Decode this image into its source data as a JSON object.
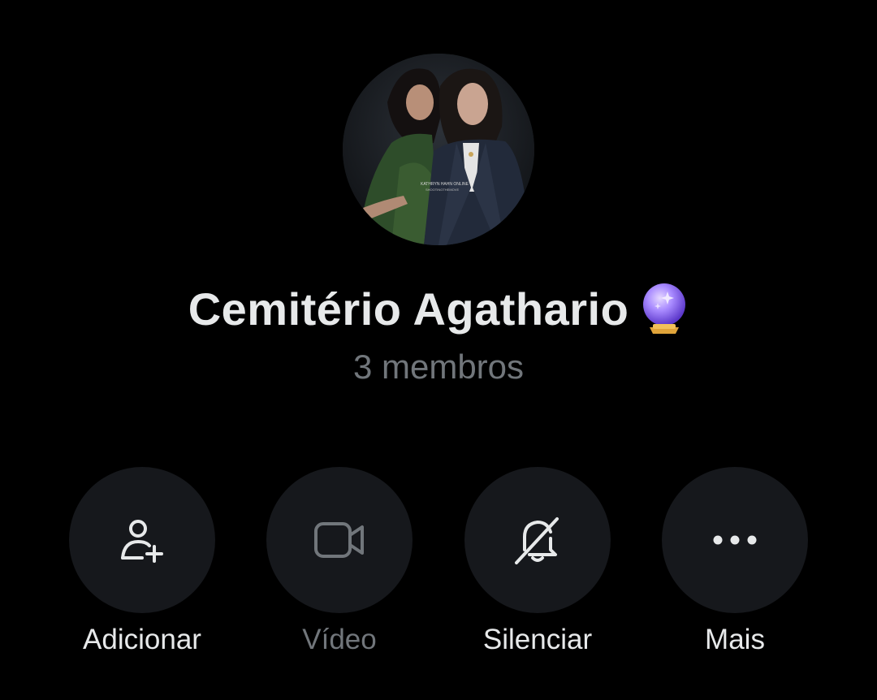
{
  "group": {
    "name": "Cemitério Agathario",
    "emoji_icon": "crystal-ball-icon",
    "members": "3 membros",
    "avatar": {
      "caption_line1": "KATHRYN HAHN ONLINE",
      "caption_line2": "SHOOTINGTHEMOVE"
    }
  },
  "actions": [
    {
      "label": "Adicionar",
      "icon": "add-user-icon",
      "enabled": true
    },
    {
      "label": "Vídeo",
      "icon": "video-camera-icon",
      "enabled": false
    },
    {
      "label": "Silenciar",
      "icon": "bell-off-icon",
      "enabled": true
    },
    {
      "label": "Mais",
      "icon": "more-dots-icon",
      "enabled": true
    }
  ],
  "colors": {
    "background": "#000000",
    "button_bg": "#16181c",
    "text_primary": "#e7e9ea",
    "text_secondary": "#71767b",
    "accent_emoji": "#a98bff"
  }
}
